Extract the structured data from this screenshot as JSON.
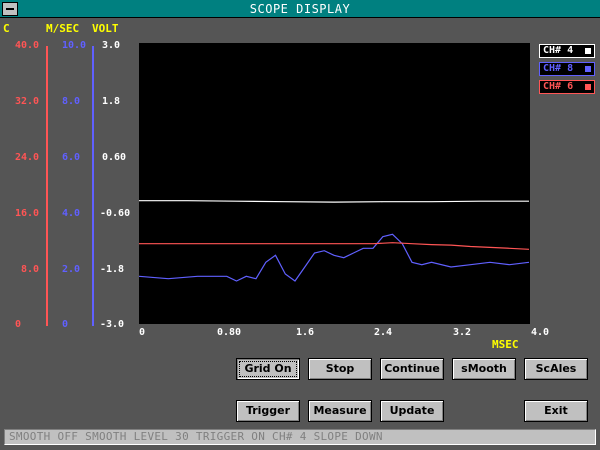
{
  "window": {
    "title": "SCOPE DISPLAY"
  },
  "axes_headers": {
    "c": "C",
    "msec": "M/SEC",
    "volt": "VOLT"
  },
  "y_axes": {
    "red": {
      "color": "#ff5555",
      "ticks": [
        "40.0",
        "32.0",
        "24.0",
        "16.0",
        "8.0",
        "0"
      ]
    },
    "blue": {
      "color": "#6060ff",
      "ticks": [
        "10.0",
        "8.0",
        "6.0",
        "4.0",
        "2.0",
        "0"
      ]
    },
    "white": {
      "color": "#ffffff",
      "ticks": [
        "3.0",
        "1.8",
        "0.60",
        "-0.60",
        "-1.8",
        "-3.0"
      ]
    }
  },
  "x_axis": {
    "ticks": [
      "0",
      "0.80",
      "1.6",
      "2.4",
      "3.2",
      "4.0"
    ],
    "unit": "MSEC"
  },
  "channels": [
    {
      "label": "CH# 4",
      "color": "#ffffff"
    },
    {
      "label": "CH# 8",
      "color": "#6060ff"
    },
    {
      "label": "CH# 6",
      "color": "#ff5555"
    }
  ],
  "chart_data": {
    "type": "line",
    "x_range": [
      0,
      4.0
    ],
    "y_range": [
      -3.0,
      3.0
    ],
    "grid": false,
    "series": [
      {
        "name": "CH# 4",
        "color": "#ffffff",
        "x": [
          0,
          0.5,
          1.0,
          1.5,
          2.0,
          2.5,
          3.0,
          3.5,
          4.0
        ],
        "y": [
          -0.38,
          -0.38,
          -0.39,
          -0.4,
          -0.41,
          -0.4,
          -0.4,
          -0.39,
          -0.39
        ]
      },
      {
        "name": "CH# 8",
        "color": "#6060ff",
        "x": [
          0,
          0.3,
          0.6,
          0.9,
          1.0,
          1.1,
          1.2,
          1.3,
          1.4,
          1.5,
          1.6,
          1.7,
          1.8,
          1.9,
          2.0,
          2.1,
          2.2,
          2.3,
          2.4,
          2.5,
          2.6,
          2.7,
          2.8,
          2.9,
          3.0,
          3.2,
          3.4,
          3.6,
          3.8,
          4.0
        ],
        "y": [
          -2.0,
          -2.05,
          -2.0,
          -2.0,
          -2.1,
          -2.0,
          -2.05,
          -1.7,
          -1.55,
          -1.95,
          -2.1,
          -1.8,
          -1.5,
          -1.45,
          -1.55,
          -1.6,
          -1.5,
          -1.4,
          -1.4,
          -1.15,
          -1.1,
          -1.3,
          -1.7,
          -1.75,
          -1.7,
          -1.8,
          -1.75,
          -1.7,
          -1.75,
          -1.7
        ]
      },
      {
        "name": "CH# 6",
        "color": "#ff5555",
        "x": [
          0,
          0.5,
          1.0,
          1.5,
          2.0,
          2.4,
          2.6,
          2.8,
          3.0,
          3.2,
          3.4,
          3.6,
          3.8,
          4.0
        ],
        "y": [
          -1.3,
          -1.3,
          -1.3,
          -1.3,
          -1.3,
          -1.3,
          -1.28,
          -1.3,
          -1.32,
          -1.33,
          -1.36,
          -1.38,
          -1.4,
          -1.42
        ]
      }
    ]
  },
  "buttons": {
    "grid_on": "Grid On",
    "stop": "Stop",
    "continue": "Continue",
    "smooth": "sMooth",
    "scales": "ScAles",
    "trigger": "Trigger",
    "measure": "Measure",
    "update": "Update",
    "exit": "Exit"
  },
  "status": "SMOOTH OFF SMOOTH LEVEL 30  TRIGGER ON CH# 4 SLOPE DOWN"
}
